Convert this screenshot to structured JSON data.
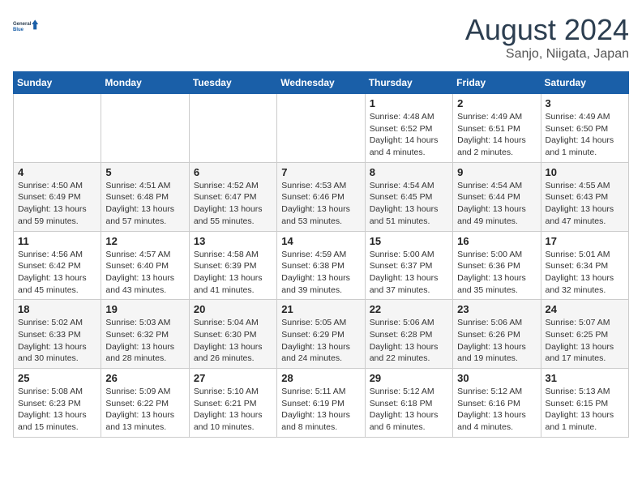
{
  "header": {
    "logo_line1": "General",
    "logo_line2": "Blue",
    "month": "August 2024",
    "location": "Sanjo, Niigata, Japan"
  },
  "days_of_week": [
    "Sunday",
    "Monday",
    "Tuesday",
    "Wednesday",
    "Thursday",
    "Friday",
    "Saturday"
  ],
  "weeks": [
    [
      {
        "day": "",
        "info": ""
      },
      {
        "day": "",
        "info": ""
      },
      {
        "day": "",
        "info": ""
      },
      {
        "day": "",
        "info": ""
      },
      {
        "day": "1",
        "info": "Sunrise: 4:48 AM\nSunset: 6:52 PM\nDaylight: 14 hours\nand 4 minutes."
      },
      {
        "day": "2",
        "info": "Sunrise: 4:49 AM\nSunset: 6:51 PM\nDaylight: 14 hours\nand 2 minutes."
      },
      {
        "day": "3",
        "info": "Sunrise: 4:49 AM\nSunset: 6:50 PM\nDaylight: 14 hours\nand 1 minute."
      }
    ],
    [
      {
        "day": "4",
        "info": "Sunrise: 4:50 AM\nSunset: 6:49 PM\nDaylight: 13 hours\nand 59 minutes."
      },
      {
        "day": "5",
        "info": "Sunrise: 4:51 AM\nSunset: 6:48 PM\nDaylight: 13 hours\nand 57 minutes."
      },
      {
        "day": "6",
        "info": "Sunrise: 4:52 AM\nSunset: 6:47 PM\nDaylight: 13 hours\nand 55 minutes."
      },
      {
        "day": "7",
        "info": "Sunrise: 4:53 AM\nSunset: 6:46 PM\nDaylight: 13 hours\nand 53 minutes."
      },
      {
        "day": "8",
        "info": "Sunrise: 4:54 AM\nSunset: 6:45 PM\nDaylight: 13 hours\nand 51 minutes."
      },
      {
        "day": "9",
        "info": "Sunrise: 4:54 AM\nSunset: 6:44 PM\nDaylight: 13 hours\nand 49 minutes."
      },
      {
        "day": "10",
        "info": "Sunrise: 4:55 AM\nSunset: 6:43 PM\nDaylight: 13 hours\nand 47 minutes."
      }
    ],
    [
      {
        "day": "11",
        "info": "Sunrise: 4:56 AM\nSunset: 6:42 PM\nDaylight: 13 hours\nand 45 minutes."
      },
      {
        "day": "12",
        "info": "Sunrise: 4:57 AM\nSunset: 6:40 PM\nDaylight: 13 hours\nand 43 minutes."
      },
      {
        "day": "13",
        "info": "Sunrise: 4:58 AM\nSunset: 6:39 PM\nDaylight: 13 hours\nand 41 minutes."
      },
      {
        "day": "14",
        "info": "Sunrise: 4:59 AM\nSunset: 6:38 PM\nDaylight: 13 hours\nand 39 minutes."
      },
      {
        "day": "15",
        "info": "Sunrise: 5:00 AM\nSunset: 6:37 PM\nDaylight: 13 hours\nand 37 minutes."
      },
      {
        "day": "16",
        "info": "Sunrise: 5:00 AM\nSunset: 6:36 PM\nDaylight: 13 hours\nand 35 minutes."
      },
      {
        "day": "17",
        "info": "Sunrise: 5:01 AM\nSunset: 6:34 PM\nDaylight: 13 hours\nand 32 minutes."
      }
    ],
    [
      {
        "day": "18",
        "info": "Sunrise: 5:02 AM\nSunset: 6:33 PM\nDaylight: 13 hours\nand 30 minutes."
      },
      {
        "day": "19",
        "info": "Sunrise: 5:03 AM\nSunset: 6:32 PM\nDaylight: 13 hours\nand 28 minutes."
      },
      {
        "day": "20",
        "info": "Sunrise: 5:04 AM\nSunset: 6:30 PM\nDaylight: 13 hours\nand 26 minutes."
      },
      {
        "day": "21",
        "info": "Sunrise: 5:05 AM\nSunset: 6:29 PM\nDaylight: 13 hours\nand 24 minutes."
      },
      {
        "day": "22",
        "info": "Sunrise: 5:06 AM\nSunset: 6:28 PM\nDaylight: 13 hours\nand 22 minutes."
      },
      {
        "day": "23",
        "info": "Sunrise: 5:06 AM\nSunset: 6:26 PM\nDaylight: 13 hours\nand 19 minutes."
      },
      {
        "day": "24",
        "info": "Sunrise: 5:07 AM\nSunset: 6:25 PM\nDaylight: 13 hours\nand 17 minutes."
      }
    ],
    [
      {
        "day": "25",
        "info": "Sunrise: 5:08 AM\nSunset: 6:23 PM\nDaylight: 13 hours\nand 15 minutes."
      },
      {
        "day": "26",
        "info": "Sunrise: 5:09 AM\nSunset: 6:22 PM\nDaylight: 13 hours\nand 13 minutes."
      },
      {
        "day": "27",
        "info": "Sunrise: 5:10 AM\nSunset: 6:21 PM\nDaylight: 13 hours\nand 10 minutes."
      },
      {
        "day": "28",
        "info": "Sunrise: 5:11 AM\nSunset: 6:19 PM\nDaylight: 13 hours\nand 8 minutes."
      },
      {
        "day": "29",
        "info": "Sunrise: 5:12 AM\nSunset: 6:18 PM\nDaylight: 13 hours\nand 6 minutes."
      },
      {
        "day": "30",
        "info": "Sunrise: 5:12 AM\nSunset: 6:16 PM\nDaylight: 13 hours\nand 4 minutes."
      },
      {
        "day": "31",
        "info": "Sunrise: 5:13 AM\nSunset: 6:15 PM\nDaylight: 13 hours\nand 1 minute."
      }
    ]
  ]
}
